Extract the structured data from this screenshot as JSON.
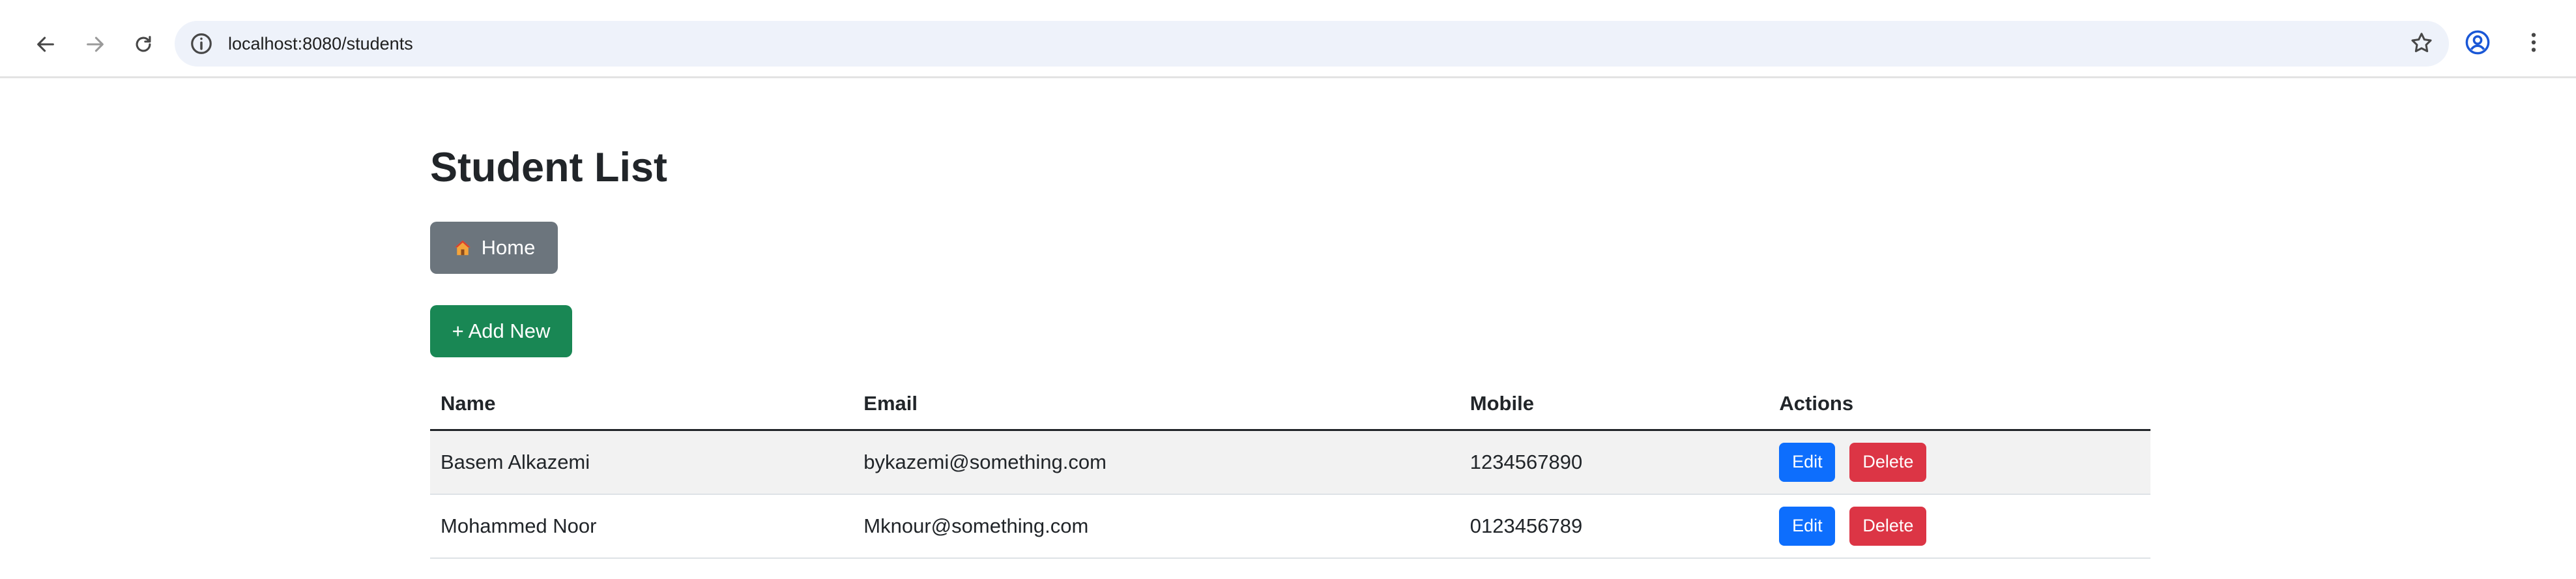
{
  "browser": {
    "url": "localhost:8080/students",
    "icons": {
      "back": "arrow-left-icon",
      "forward": "arrow-right-icon",
      "reload": "reload-icon",
      "site_info": "info-icon",
      "bookmark": "star-icon",
      "profile": "profile-icon",
      "menu": "kebab-menu-icon"
    }
  },
  "page": {
    "title": "Student List",
    "home_button": {
      "icon": "home-icon",
      "label": "Home"
    },
    "add_button": {
      "label": "+ Add New"
    }
  },
  "table": {
    "headers": {
      "name": "Name",
      "email": "Email",
      "mobile": "Mobile",
      "actions": "Actions"
    },
    "rows": [
      {
        "name": "Basem Alkazemi",
        "email": "bykazemi@something.com",
        "mobile": "1234567890",
        "edit": "Edit",
        "delete": "Delete"
      },
      {
        "name": "Mohammed Noor",
        "email": "Mknour@something.com",
        "mobile": "0123456789",
        "edit": "Edit",
        "delete": "Delete"
      }
    ]
  },
  "colors": {
    "home_button": "#6c757d",
    "add_button": "#198754",
    "edit_button": "#0d6efd",
    "delete_button": "#dc3545"
  }
}
